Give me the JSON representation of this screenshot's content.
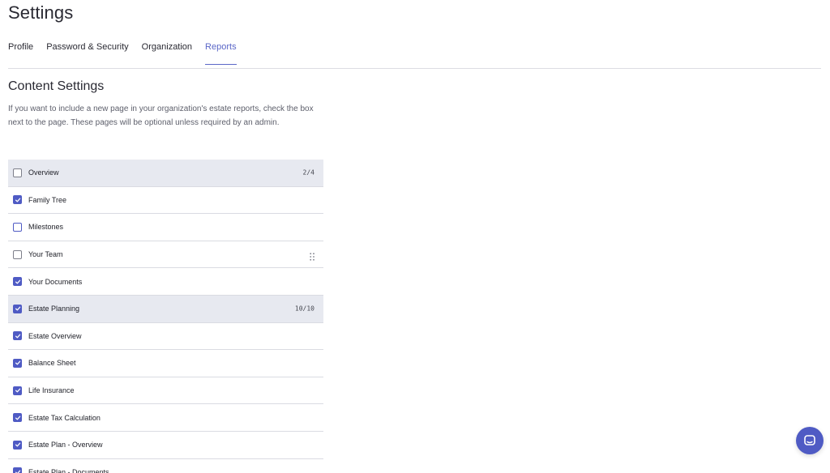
{
  "page": {
    "title": "Settings"
  },
  "tabs": [
    {
      "label": "Profile",
      "active": false
    },
    {
      "label": "Password & Security",
      "active": false
    },
    {
      "label": "Organization",
      "active": false
    },
    {
      "label": "Reports",
      "active": true
    }
  ],
  "content": {
    "heading": "Content Settings",
    "description": "If you want to include a new page in your organization's estate reports, check the box next to the page. These pages will be optional unless required by an admin."
  },
  "rows": [
    {
      "label": "Overview",
      "checked": false,
      "group": true,
      "count": "2/4"
    },
    {
      "label": "Family Tree",
      "checked": true
    },
    {
      "label": "Milestones",
      "checked": false,
      "focus": true
    },
    {
      "label": "Your Team",
      "checked": false,
      "drag": true
    },
    {
      "label": "Your Documents",
      "checked": true
    },
    {
      "label": "Estate Planning",
      "checked": true,
      "group": true,
      "count": "10/10"
    },
    {
      "label": "Estate Overview",
      "checked": true
    },
    {
      "label": "Balance Sheet",
      "checked": true
    },
    {
      "label": "Life Insurance",
      "checked": true
    },
    {
      "label": "Estate Tax Calculation",
      "checked": true
    },
    {
      "label": "Estate Plan - Overview",
      "checked": true
    },
    {
      "label": "Estate Plan - Documents",
      "checked": true
    }
  ],
  "colors": {
    "accent": "#4f5bc4",
    "active_tab": "#5b67c8",
    "group_row_bg": "#e7e9f0"
  },
  "icons": {
    "chat": "chat-bubble-icon",
    "check": "checkmark-icon",
    "drag": "drag-handle-icon"
  }
}
